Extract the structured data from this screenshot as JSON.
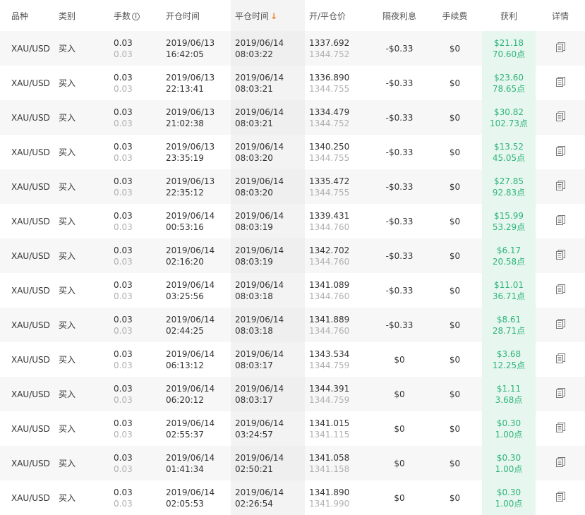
{
  "headers": {
    "symbol": "品种",
    "type": "类别",
    "lots": "手数",
    "open_time": "开仓时间",
    "close_time": "平仓时间",
    "price": "开/平仓价",
    "swap": "隔夜利息",
    "fee": "手续费",
    "profit": "获利",
    "details": "详情"
  },
  "sort": {
    "column": "close_time",
    "direction": "desc",
    "arrow_color": "#f08228"
  },
  "colors": {
    "profit_text": "#2fb47a",
    "profit_bg": "#e7f7ef"
  },
  "rows": [
    {
      "symbol": "XAU/USD",
      "type": "买入",
      "lots_open": "0.03",
      "lots_close": "0.03",
      "open_date": "2019/06/13",
      "open_time": "16:42:05",
      "close_date": "2019/06/14",
      "close_time": "08:03:22",
      "open_price": "1337.692",
      "close_price": "1344.752",
      "swap": "-$0.33",
      "fee": "$0",
      "profit": "$21.18",
      "points": "70.60点"
    },
    {
      "symbol": "XAU/USD",
      "type": "买入",
      "lots_open": "0.03",
      "lots_close": "0.03",
      "open_date": "2019/06/13",
      "open_time": "22:13:41",
      "close_date": "2019/06/14",
      "close_time": "08:03:21",
      "open_price": "1336.890",
      "close_price": "1344.755",
      "swap": "-$0.33",
      "fee": "$0",
      "profit": "$23.60",
      "points": "78.65点"
    },
    {
      "symbol": "XAU/USD",
      "type": "买入",
      "lots_open": "0.03",
      "lots_close": "0.03",
      "open_date": "2019/06/13",
      "open_time": "21:02:38",
      "close_date": "2019/06/14",
      "close_time": "08:03:21",
      "open_price": "1334.479",
      "close_price": "1344.752",
      "swap": "-$0.33",
      "fee": "$0",
      "profit": "$30.82",
      "points": "102.73点"
    },
    {
      "symbol": "XAU/USD",
      "type": "买入",
      "lots_open": "0.03",
      "lots_close": "0.03",
      "open_date": "2019/06/13",
      "open_time": "23:35:19",
      "close_date": "2019/06/14",
      "close_time": "08:03:20",
      "open_price": "1340.250",
      "close_price": "1344.755",
      "swap": "-$0.33",
      "fee": "$0",
      "profit": "$13.52",
      "points": "45.05点"
    },
    {
      "symbol": "XAU/USD",
      "type": "买入",
      "lots_open": "0.03",
      "lots_close": "0.03",
      "open_date": "2019/06/13",
      "open_time": "22:35:12",
      "close_date": "2019/06/14",
      "close_time": "08:03:20",
      "open_price": "1335.472",
      "close_price": "1344.755",
      "swap": "-$0.33",
      "fee": "$0",
      "profit": "$27.85",
      "points": "92.83点"
    },
    {
      "symbol": "XAU/USD",
      "type": "买入",
      "lots_open": "0.03",
      "lots_close": "0.03",
      "open_date": "2019/06/14",
      "open_time": "00:53:16",
      "close_date": "2019/06/14",
      "close_time": "08:03:19",
      "open_price": "1339.431",
      "close_price": "1344.760",
      "swap": "-$0.33",
      "fee": "$0",
      "profit": "$15.99",
      "points": "53.29点"
    },
    {
      "symbol": "XAU/USD",
      "type": "买入",
      "lots_open": "0.03",
      "lots_close": "0.03",
      "open_date": "2019/06/14",
      "open_time": "02:16:20",
      "close_date": "2019/06/14",
      "close_time": "08:03:19",
      "open_price": "1342.702",
      "close_price": "1344.760",
      "swap": "-$0.33",
      "fee": "$0",
      "profit": "$6.17",
      "points": "20.58点"
    },
    {
      "symbol": "XAU/USD",
      "type": "买入",
      "lots_open": "0.03",
      "lots_close": "0.03",
      "open_date": "2019/06/14",
      "open_time": "03:25:56",
      "close_date": "2019/06/14",
      "close_time": "08:03:18",
      "open_price": "1341.089",
      "close_price": "1344.760",
      "swap": "-$0.33",
      "fee": "$0",
      "profit": "$11.01",
      "points": "36.71点"
    },
    {
      "symbol": "XAU/USD",
      "type": "买入",
      "lots_open": "0.03",
      "lots_close": "0.03",
      "open_date": "2019/06/14",
      "open_time": "02:44:25",
      "close_date": "2019/06/14",
      "close_time": "08:03:18",
      "open_price": "1341.889",
      "close_price": "1344.760",
      "swap": "-$0.33",
      "fee": "$0",
      "profit": "$8.61",
      "points": "28.71点"
    },
    {
      "symbol": "XAU/USD",
      "type": "买入",
      "lots_open": "0.03",
      "lots_close": "0.03",
      "open_date": "2019/06/14",
      "open_time": "06:13:12",
      "close_date": "2019/06/14",
      "close_time": "08:03:17",
      "open_price": "1343.534",
      "close_price": "1344.759",
      "swap": "$0",
      "fee": "$0",
      "profit": "$3.68",
      "points": "12.25点"
    },
    {
      "symbol": "XAU/USD",
      "type": "买入",
      "lots_open": "0.03",
      "lots_close": "0.03",
      "open_date": "2019/06/14",
      "open_time": "06:20:12",
      "close_date": "2019/06/14",
      "close_time": "08:03:17",
      "open_price": "1344.391",
      "close_price": "1344.759",
      "swap": "$0",
      "fee": "$0",
      "profit": "$1.11",
      "points": "3.68点"
    },
    {
      "symbol": "XAU/USD",
      "type": "买入",
      "lots_open": "0.03",
      "lots_close": "0.03",
      "open_date": "2019/06/14",
      "open_time": "02:55:37",
      "close_date": "2019/06/14",
      "close_time": "03:24:57",
      "open_price": "1341.015",
      "close_price": "1341.115",
      "swap": "$0",
      "fee": "$0",
      "profit": "$0.30",
      "points": "1.00点"
    },
    {
      "symbol": "XAU/USD",
      "type": "买入",
      "lots_open": "0.03",
      "lots_close": "0.03",
      "open_date": "2019/06/14",
      "open_time": "01:41:34",
      "close_date": "2019/06/14",
      "close_time": "02:50:21",
      "open_price": "1341.058",
      "close_price": "1341.158",
      "swap": "$0",
      "fee": "$0",
      "profit": "$0.30",
      "points": "1.00点"
    },
    {
      "symbol": "XAU/USD",
      "type": "买入",
      "lots_open": "0.03",
      "lots_close": "0.03",
      "open_date": "2019/06/14",
      "open_time": "02:05:53",
      "close_date": "2019/06/14",
      "close_time": "02:26:54",
      "open_price": "1341.890",
      "close_price": "1341.990",
      "swap": "$0",
      "fee": "$0",
      "profit": "$0.30",
      "points": "1.00点"
    }
  ]
}
